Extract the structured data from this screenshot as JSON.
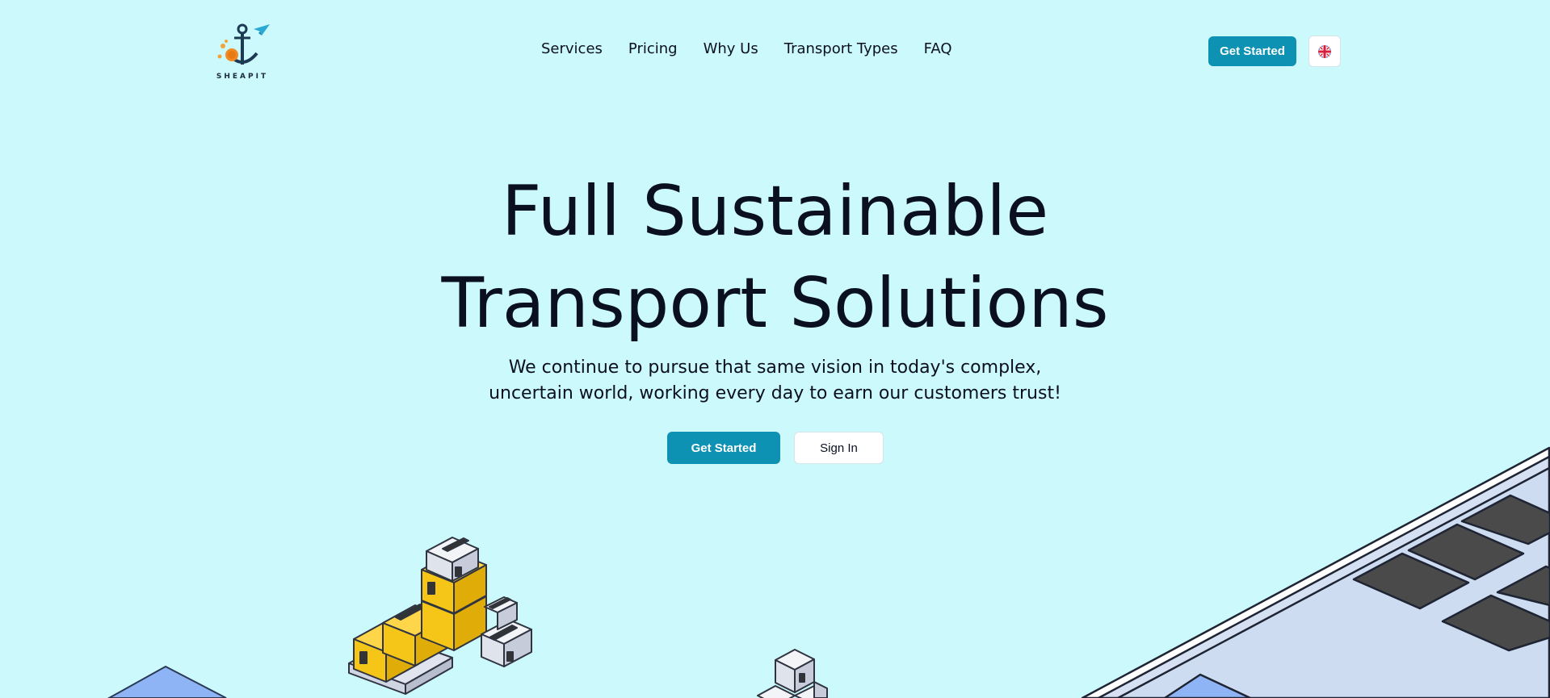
{
  "brand": {
    "name": "SHEAPIT"
  },
  "nav": {
    "items": [
      {
        "label": "Services"
      },
      {
        "label": "Pricing"
      },
      {
        "label": "Why Us"
      },
      {
        "label": "Transport Types"
      },
      {
        "label": "FAQ"
      }
    ]
  },
  "header": {
    "cta_label": "Get Started",
    "language_flag": "uk-flag-icon"
  },
  "hero": {
    "title_line1": "Full Sustainable",
    "title_line2": "Transport Solutions",
    "subtitle_line1": "We continue to pursue that same vision in today's complex,",
    "subtitle_line2": "uncertain world, working every day to earn our customers trust!",
    "primary_label": "Get Started",
    "secondary_label": "Sign In"
  },
  "colors": {
    "background": "#ccf9fc",
    "accent": "#0e92b3",
    "text": "#0b1020"
  }
}
